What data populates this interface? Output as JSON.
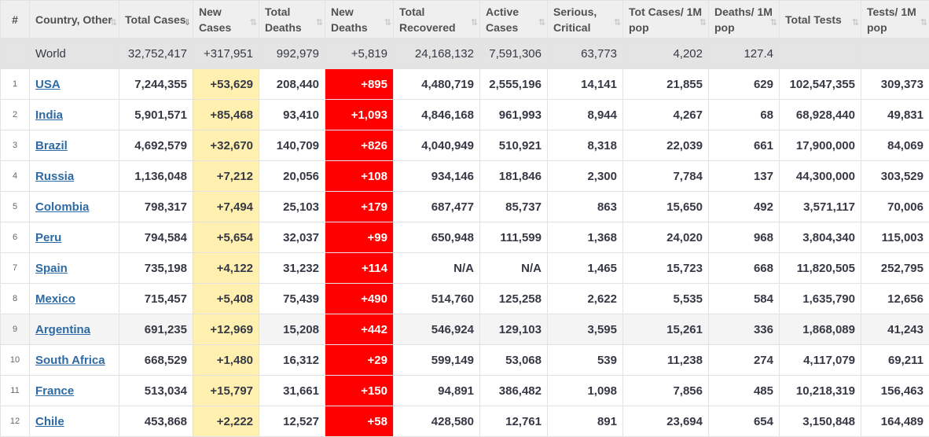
{
  "headers": [
    {
      "label": "#"
    },
    {
      "label": "Country, Other"
    },
    {
      "label": "Total Cases"
    },
    {
      "label": "New Cases"
    },
    {
      "label": "Total Deaths"
    },
    {
      "label": "New Deaths"
    },
    {
      "label": "Total Recovered"
    },
    {
      "label": "Active Cases"
    },
    {
      "label": "Serious, Critical"
    },
    {
      "label": "Tot Cases/ 1M pop"
    },
    {
      "label": "Deaths/ 1M pop"
    },
    {
      "label": "Total Tests"
    },
    {
      "label": "Tests/ 1M pop"
    }
  ],
  "sort_glyph": "⇅",
  "sort_active_glyph": "⇓",
  "world": {
    "country": "World",
    "total_cases": "32,752,417",
    "new_cases": "+317,951",
    "total_deaths": "992,979",
    "new_deaths": "+5,819",
    "total_recovered": "24,168,132",
    "active_cases": "7,591,306",
    "serious": "63,773",
    "cases_per_1m": "4,202",
    "deaths_per_1m": "127.4",
    "total_tests": "",
    "tests_per_1m": ""
  },
  "rows": [
    {
      "idx": "1",
      "country": "USA",
      "total_cases": "7,244,355",
      "new_cases": "+53,629",
      "total_deaths": "208,440",
      "new_deaths": "+895",
      "total_recovered": "4,480,719",
      "active_cases": "2,555,196",
      "serious": "14,141",
      "cases_per_1m": "21,855",
      "deaths_per_1m": "629",
      "total_tests": "102,547,355",
      "tests_per_1m": "309,373"
    },
    {
      "idx": "2",
      "country": "India",
      "total_cases": "5,901,571",
      "new_cases": "+85,468",
      "total_deaths": "93,410",
      "new_deaths": "+1,093",
      "total_recovered": "4,846,168",
      "active_cases": "961,993",
      "serious": "8,944",
      "cases_per_1m": "4,267",
      "deaths_per_1m": "68",
      "total_tests": "68,928,440",
      "tests_per_1m": "49,831"
    },
    {
      "idx": "3",
      "country": "Brazil",
      "total_cases": "4,692,579",
      "new_cases": "+32,670",
      "total_deaths": "140,709",
      "new_deaths": "+826",
      "total_recovered": "4,040,949",
      "active_cases": "510,921",
      "serious": "8,318",
      "cases_per_1m": "22,039",
      "deaths_per_1m": "661",
      "total_tests": "17,900,000",
      "tests_per_1m": "84,069"
    },
    {
      "idx": "4",
      "country": "Russia",
      "total_cases": "1,136,048",
      "new_cases": "+7,212",
      "total_deaths": "20,056",
      "new_deaths": "+108",
      "total_recovered": "934,146",
      "active_cases": "181,846",
      "serious": "2,300",
      "cases_per_1m": "7,784",
      "deaths_per_1m": "137",
      "total_tests": "44,300,000",
      "tests_per_1m": "303,529"
    },
    {
      "idx": "5",
      "country": "Colombia",
      "total_cases": "798,317",
      "new_cases": "+7,494",
      "total_deaths": "25,103",
      "new_deaths": "+179",
      "total_recovered": "687,477",
      "active_cases": "85,737",
      "serious": "863",
      "cases_per_1m": "15,650",
      "deaths_per_1m": "492",
      "total_tests": "3,571,117",
      "tests_per_1m": "70,006"
    },
    {
      "idx": "6",
      "country": "Peru",
      "total_cases": "794,584",
      "new_cases": "+5,654",
      "total_deaths": "32,037",
      "new_deaths": "+99",
      "total_recovered": "650,948",
      "active_cases": "111,599",
      "serious": "1,368",
      "cases_per_1m": "24,020",
      "deaths_per_1m": "968",
      "total_tests": "3,804,340",
      "tests_per_1m": "115,003"
    },
    {
      "idx": "7",
      "country": "Spain",
      "total_cases": "735,198",
      "new_cases": "+4,122",
      "total_deaths": "31,232",
      "new_deaths": "+114",
      "total_recovered": "N/A",
      "active_cases": "N/A",
      "serious": "1,465",
      "cases_per_1m": "15,723",
      "deaths_per_1m": "668",
      "total_tests": "11,820,505",
      "tests_per_1m": "252,795"
    },
    {
      "idx": "8",
      "country": "Mexico",
      "total_cases": "715,457",
      "new_cases": "+5,408",
      "total_deaths": "75,439",
      "new_deaths": "+490",
      "total_recovered": "514,760",
      "active_cases": "125,258",
      "serious": "2,622",
      "cases_per_1m": "5,535",
      "deaths_per_1m": "584",
      "total_tests": "1,635,790",
      "tests_per_1m": "12,656"
    },
    {
      "idx": "9",
      "country": "Argentina",
      "total_cases": "691,235",
      "new_cases": "+12,969",
      "total_deaths": "15,208",
      "new_deaths": "+442",
      "total_recovered": "546,924",
      "active_cases": "129,103",
      "serious": "3,595",
      "cases_per_1m": "15,261",
      "deaths_per_1m": "336",
      "total_tests": "1,868,089",
      "tests_per_1m": "41,243",
      "alt": true
    },
    {
      "idx": "10",
      "country": "South Africa",
      "total_cases": "668,529",
      "new_cases": "+1,480",
      "total_deaths": "16,312",
      "new_deaths": "+29",
      "total_recovered": "599,149",
      "active_cases": "53,068",
      "serious": "539",
      "cases_per_1m": "11,238",
      "deaths_per_1m": "274",
      "total_tests": "4,117,079",
      "tests_per_1m": "69,211"
    },
    {
      "idx": "11",
      "country": "France",
      "total_cases": "513,034",
      "new_cases": "+15,797",
      "total_deaths": "31,661",
      "new_deaths": "+150",
      "total_recovered": "94,891",
      "active_cases": "386,482",
      "serious": "1,098",
      "cases_per_1m": "7,856",
      "deaths_per_1m": "485",
      "total_tests": "10,218,319",
      "tests_per_1m": "156,463"
    },
    {
      "idx": "12",
      "country": "Chile",
      "total_cases": "453,868",
      "new_cases": "+2,222",
      "total_deaths": "12,527",
      "new_deaths": "+58",
      "total_recovered": "428,580",
      "active_cases": "12,761",
      "serious": "891",
      "cases_per_1m": "23,694",
      "deaths_per_1m": "654",
      "total_tests": "3,150,848",
      "tests_per_1m": "164,489"
    }
  ],
  "colors": {
    "new_cases_bg": "#fff0b0",
    "new_deaths_bg": "#ff0000",
    "world_bg": "#e4e4e4",
    "link": "#2e6aa3"
  }
}
